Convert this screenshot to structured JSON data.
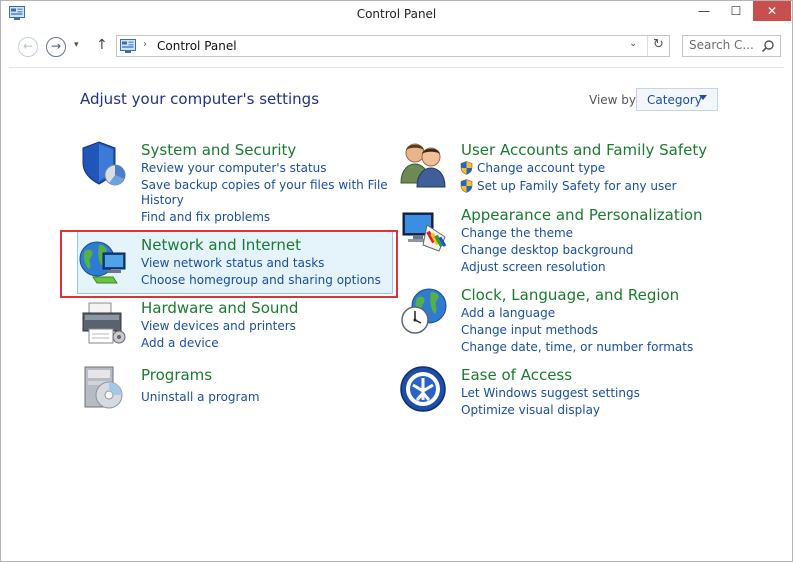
{
  "window": {
    "title": "Control Panel"
  },
  "titlebar": {
    "minimize": "—",
    "maximize": "☐",
    "close": "✕"
  },
  "nav": {
    "back": "←",
    "forward": "→",
    "recent": "▾",
    "up": "↑",
    "address": {
      "chevron": "›",
      "text": "Control Panel",
      "dropdown": "⌄",
      "refresh": "↻"
    },
    "search": {
      "placeholder": "Search C..."
    }
  },
  "main": {
    "heading": "Adjust your computer's settings",
    "view_by": {
      "label": "View by:",
      "value": "Category"
    }
  },
  "left_categories": [
    {
      "title": "System and Security",
      "icon": "shield-icon",
      "links": [
        "Review your computer's status",
        "Save backup copies of your files with File",
        "History",
        "Find and fix problems"
      ]
    },
    {
      "title": "Network and Internet",
      "icon": "globe-network-icon",
      "links": [
        "View network status and tasks",
        "Choose homegroup and sharing options"
      ]
    },
    {
      "title": "Hardware and Sound",
      "icon": "printer-icon",
      "links": [
        "View devices and printers",
        "Add a device"
      ]
    },
    {
      "title": "Programs",
      "icon": "programs-icon",
      "links": [
        "Uninstall a program"
      ]
    }
  ],
  "right_categories": [
    {
      "title": "User Accounts and Family Safety",
      "icon": "users-icon",
      "links": [
        "Change account type",
        "Set up Family Safety for any user"
      ]
    },
    {
      "title": "Appearance and Personalization",
      "icon": "monitor-palette-icon",
      "links": [
        "Change the theme",
        "Change desktop background",
        "Adjust screen resolution"
      ]
    },
    {
      "title": "Clock, Language, and Region",
      "icon": "clock-globe-icon",
      "links": [
        "Add a language",
        "Change input methods",
        "Change date, time, or number formats"
      ]
    },
    {
      "title": "Ease of Access",
      "icon": "ease-of-access-icon",
      "links": [
        "Let Windows suggest settings",
        "Optimize visual display"
      ]
    }
  ],
  "colors": {
    "category_title": "#1a7a30",
    "link": "#1a4fa0",
    "heading": "#1e3287",
    "selection_highlight": "#e5f3fb",
    "annotation_box": "#e03039"
  }
}
